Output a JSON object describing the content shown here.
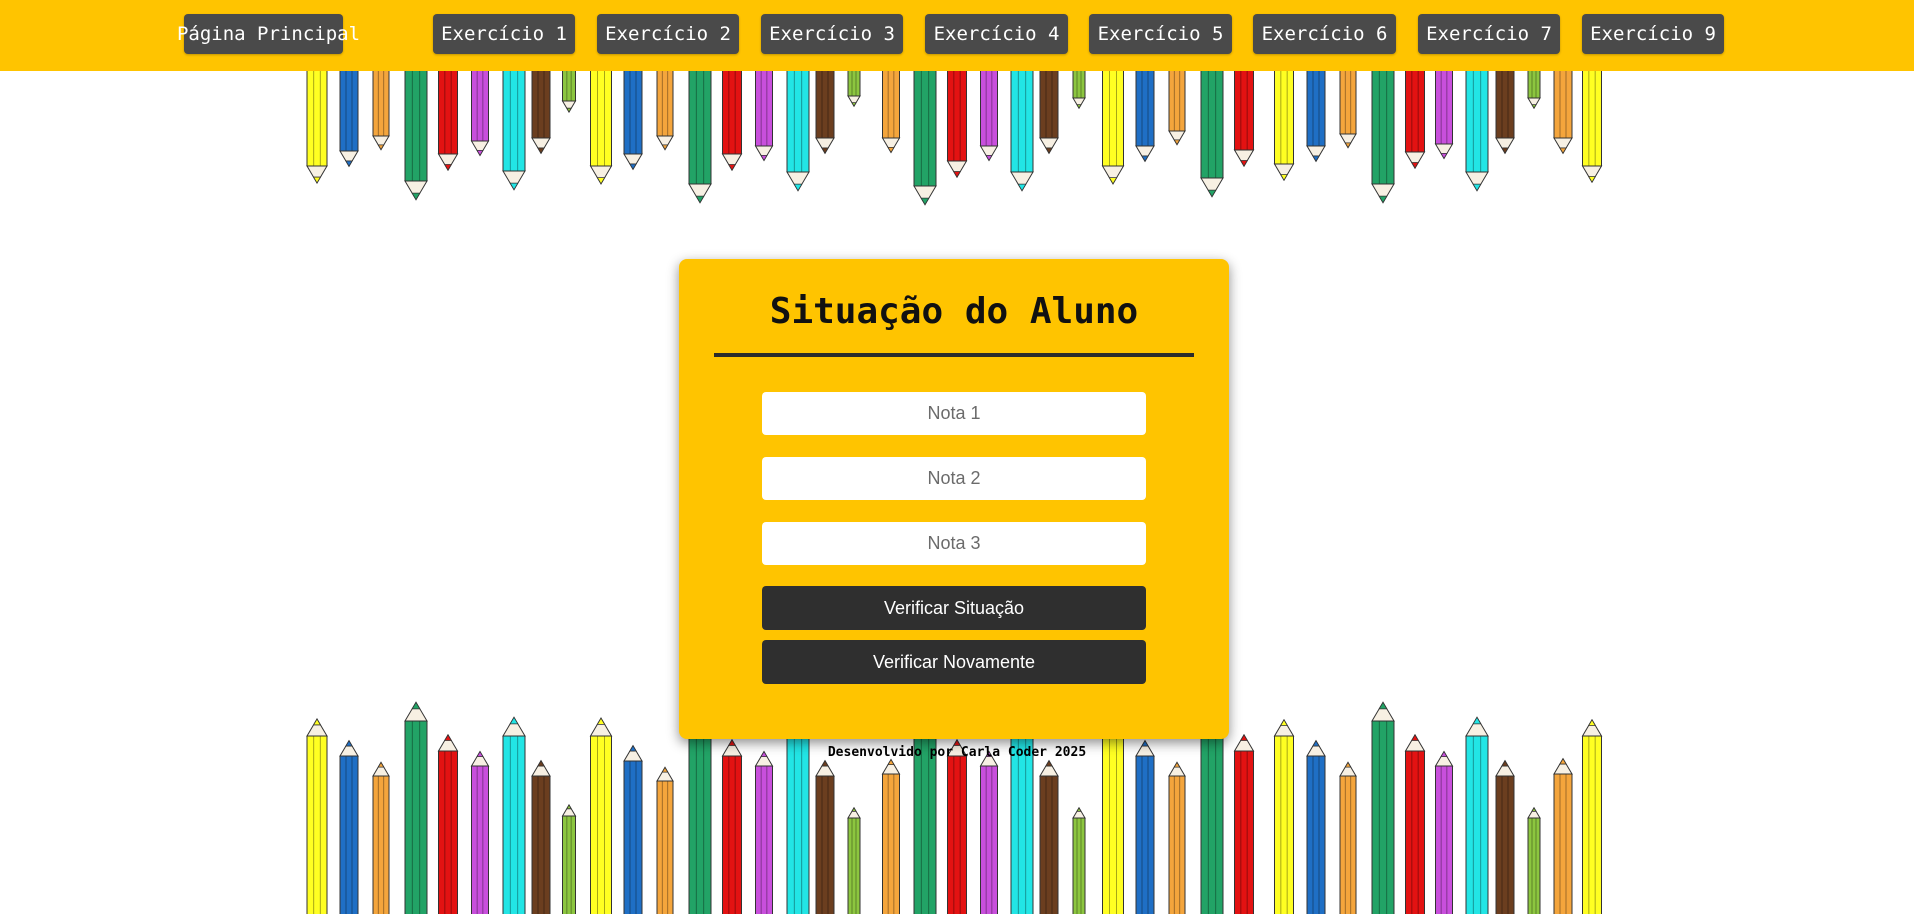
{
  "nav": {
    "home_label": "Página Principal",
    "items": [
      "Exercício 1",
      "Exercício 2",
      "Exercício 3",
      "Exercício 4",
      "Exercício 5",
      "Exercício 6",
      "Exercício 7",
      "Exercício 9"
    ]
  },
  "card": {
    "title": "Situação do Aluno",
    "fields": [
      {
        "placeholder": "Nota 1",
        "value": ""
      },
      {
        "placeholder": "Nota 2",
        "value": ""
      },
      {
        "placeholder": "Nota 3",
        "value": ""
      }
    ],
    "verify_label": "Verificar Situação",
    "retry_label": "Verificar Novamente"
  },
  "footer": {
    "text": "Desenvolvido por Carla Coder 2025"
  },
  "colors": {
    "accent": "#ffc400",
    "nav_button": "#4a4a4a",
    "action_button": "#2f2f2f",
    "pencils": [
      "#ffff22",
      "#1f6fc5",
      "#f4a53c",
      "#22a366",
      "#e31212",
      "#c84fdc",
      "#22e5e5",
      "#6b3e1f",
      "#8cc63f"
    ]
  },
  "icons": {
    "home": "house-icon",
    "decoration": "colored-pencil-icon"
  }
}
